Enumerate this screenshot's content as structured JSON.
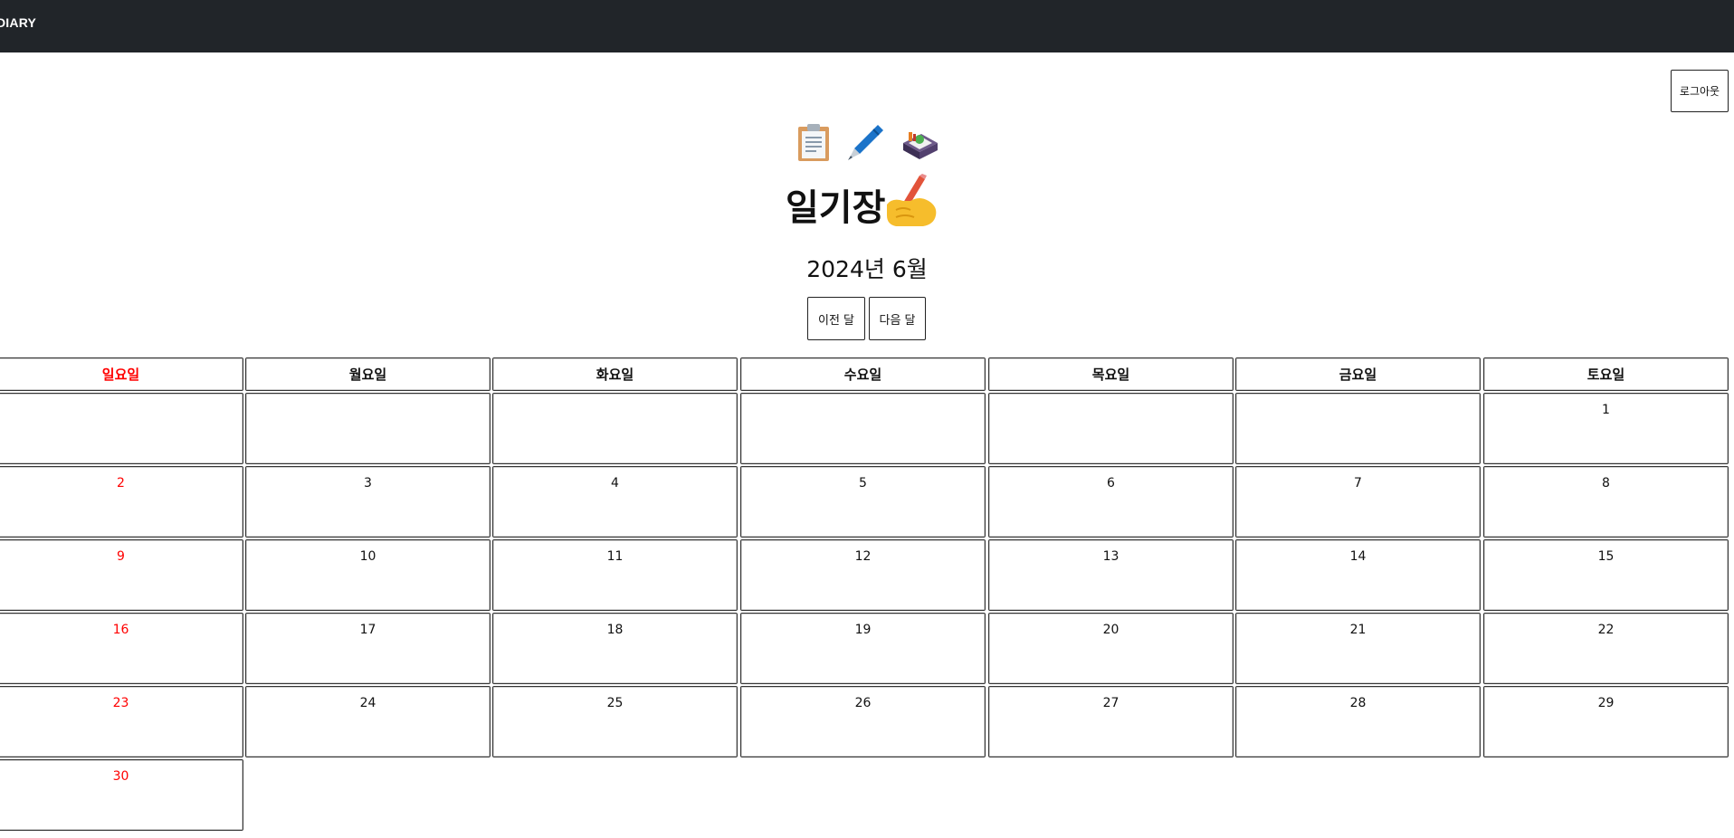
{
  "navbar": {
    "brand": "DIARY"
  },
  "logout_label": "로그아웃",
  "header": {
    "icons": [
      "clipboard-icon",
      "pen-icon",
      "notebox-icon"
    ],
    "title": "일기장",
    "title_icon": "writing-hand-icon"
  },
  "month": {
    "label": "2024년 6월"
  },
  "nav": {
    "prev_label": "이전 달",
    "next_label": "다음 달"
  },
  "colors": {
    "navbar": "#212529",
    "sunday": "#ff0000"
  },
  "calendar": {
    "weekdays": [
      "일요일",
      "월요일",
      "화요일",
      "수요일",
      "목요일",
      "금요일",
      "토요일"
    ],
    "weeks": [
      [
        "",
        "",
        "",
        "",
        "",
        "",
        "1"
      ],
      [
        "2",
        "3",
        "4",
        "5",
        "6",
        "7",
        "8"
      ],
      [
        "9",
        "10",
        "11",
        "12",
        "13",
        "14",
        "15"
      ],
      [
        "16",
        "17",
        "18",
        "19",
        "20",
        "21",
        "22"
      ],
      [
        "23",
        "24",
        "25",
        "26",
        "27",
        "28",
        "29"
      ],
      [
        "30"
      ]
    ]
  }
}
